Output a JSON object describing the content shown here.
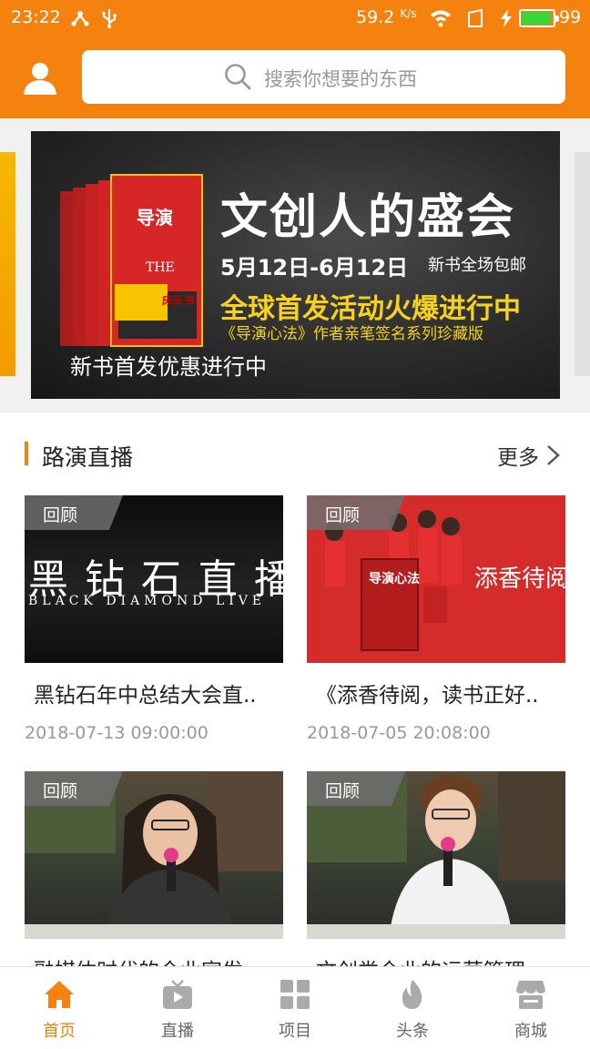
{
  "status_bar": {
    "time": "23:22",
    "speed": "59.2",
    "speed_unit": "K/s",
    "battery": "99"
  },
  "header": {
    "search_placeholder": "搜索你想要的东西"
  },
  "banner": {
    "title": "文创人的盛会",
    "date_range": "5月12日-6月12日",
    "shipping": "新书全场包邮",
    "headline": "全球首发活动火爆进行中",
    "subline": "《导演心法》作者亲笔签名系列珍藏版",
    "caption": "新书首发优惠进行中",
    "book_title": "导演心法",
    "book_sticker": "床头书"
  },
  "section": {
    "title": "路演直播",
    "more": "更多"
  },
  "cards": [
    {
      "badge": "回顾",
      "title": "黑钻石年中总结大会直..",
      "time": "2018-07-13 09:00:00",
      "thumb_text_cn": "黑钻石直播",
      "thumb_text_en": "BLACK DIAMOND LIVE"
    },
    {
      "badge": "回顾",
      "title": "《添香待阅，读书正好..",
      "time": "2018-07-05 20:08:00",
      "thumb_text_cn": "添香待阅",
      "thumb_book": "导演心法"
    },
    {
      "badge": "回顾",
      "title": "融媒体时代的企业宣发..."
    },
    {
      "badge": "回顾",
      "title": "文创类企业的运营管理..."
    }
  ],
  "tabbar": {
    "tabs": [
      {
        "label": "首页",
        "icon": "home-icon",
        "active": true
      },
      {
        "label": "直播",
        "icon": "live-icon",
        "active": false
      },
      {
        "label": "项目",
        "icon": "grid-icon",
        "active": false
      },
      {
        "label": "头条",
        "icon": "flame-icon",
        "active": false
      },
      {
        "label": "商城",
        "icon": "shop-icon",
        "active": false
      }
    ]
  },
  "colors": {
    "accent": "#f5820f",
    "banner_highlight": "#f7d21c"
  }
}
